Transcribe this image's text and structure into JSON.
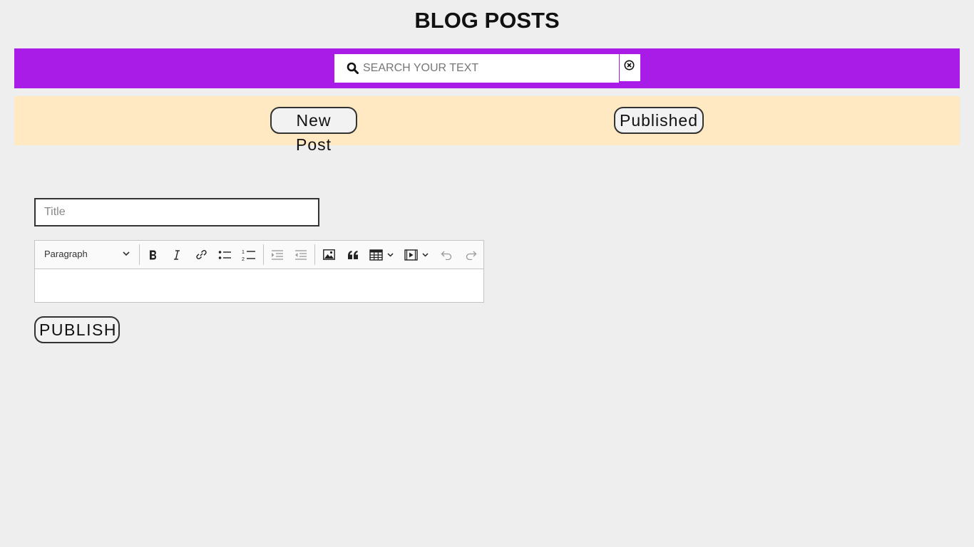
{
  "header": {
    "title": "BLOG POSTS"
  },
  "search": {
    "placeholder": "SEARCH YOUR TEXT",
    "value": "",
    "icon": "search-icon",
    "clear_icon": "close-circle-icon"
  },
  "nav": {
    "new_post_label": "New Post",
    "published_label": "Published"
  },
  "editor": {
    "title_placeholder": "Title",
    "title_value": "",
    "heading_select_value": "Paragraph",
    "toolbar_icons": [
      "bold-icon",
      "italic-icon",
      "link-icon",
      "bulleted-list-icon",
      "numbered-list-icon",
      "outdent-icon",
      "indent-icon",
      "image-icon",
      "quote-icon",
      "table-icon",
      "media-icon",
      "undo-icon",
      "redo-icon"
    ],
    "content": ""
  },
  "actions": {
    "publish_label": "PUBLISH"
  },
  "colors": {
    "background": "#eeeeee",
    "search_bar": "#a91be6",
    "nav_bar": "#ffe9c2",
    "border": "#333333"
  }
}
